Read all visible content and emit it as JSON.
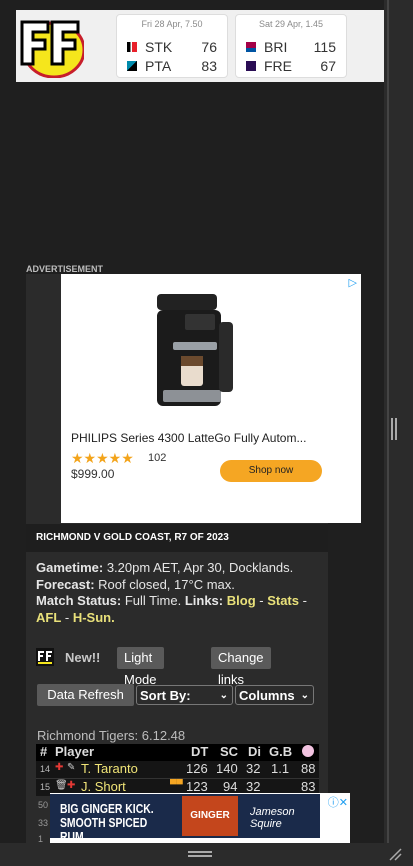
{
  "scores": [
    {
      "when": "Fri 28 Apr, 7.50",
      "teams": [
        {
          "abbr": "STK",
          "score": "76",
          "color": "#e8202a"
        },
        {
          "abbr": "PTA",
          "score": "83",
          "color": "#008aab"
        }
      ]
    },
    {
      "when": "Sat 29 Apr, 1.45",
      "teams": [
        {
          "abbr": "BRI",
          "score": "115",
          "color": "#a30046"
        },
        {
          "abbr": "FRE",
          "score": "67",
          "color": "#2a0d54"
        }
      ]
    }
  ],
  "ads": {
    "label": "ADVERTISEMENT",
    "product_title": "PHILIPS Series 4300 LatteGo Fully Autom...",
    "stars": "★★★★★",
    "rating_count": "102",
    "price": "$999.00",
    "cta": "Shop now",
    "banner_text": "BIG GINGER KICK. SMOOTH SPICED RUM.",
    "banner_can": "GINGER BEER",
    "banner_brand": "Jameson Squire"
  },
  "match": {
    "header": "RICHMOND V GOLD COAST, R7 OF 2023",
    "gametime_label": "Gametime:",
    "gametime": "3.20pm AET, Apr 30, Docklands.",
    "forecast_label": "Forecast:",
    "forecast": "Roof closed, 17°C max.",
    "status_label": "Match Status:",
    "status": "Full Time.",
    "links_label": "Links:",
    "links": [
      "Blog",
      "Stats",
      "AFL",
      "H-Sun."
    ]
  },
  "controls": {
    "new_label": "New!!",
    "light_mode": "Light Mode",
    "change_links": "Change links",
    "data_refresh": "Data Refresh",
    "sort_by": "Sort By:",
    "columns": "Columns"
  },
  "team": {
    "name": "Richmond Tigers: 6.12.48",
    "columns": [
      "#",
      "Player",
      "DT",
      "SC",
      "Di",
      "G.B"
    ],
    "rows": [
      {
        "num": "14",
        "name": "T. Taranto",
        "dt": "126",
        "sc": "140",
        "di": "32",
        "gb": "1.1",
        "extra": "88"
      },
      {
        "num": "15",
        "name": "J. Short",
        "dt": "123",
        "sc": "94",
        "di": "32",
        "gb": "",
        "extra": "83"
      }
    ],
    "partial_nums": [
      "50",
      "33",
      "1"
    ]
  }
}
